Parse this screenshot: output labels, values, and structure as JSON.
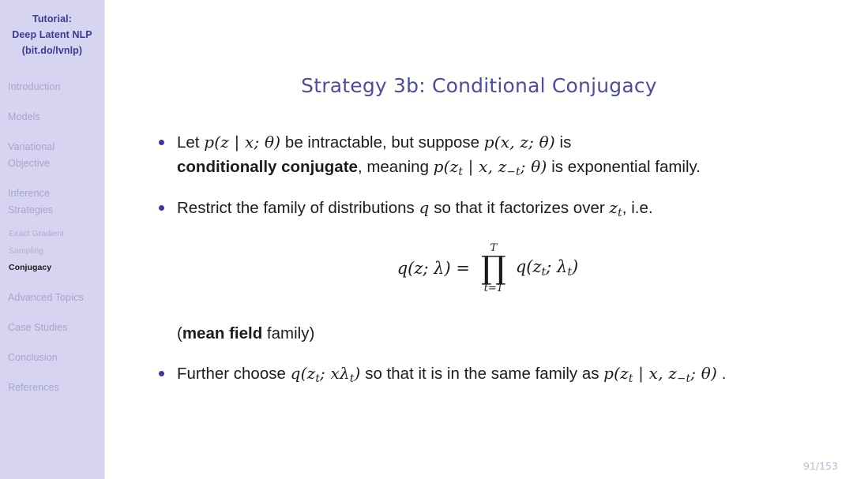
{
  "sidebar": {
    "title_lines": [
      "Tutorial:",
      "Deep Latent NLP",
      "(bit.do/lvnlp)"
    ],
    "sections": [
      {
        "lines": [
          "Introduction"
        ]
      },
      {
        "lines": [
          "Models"
        ]
      },
      {
        "lines": [
          "Variational",
          "Objective"
        ]
      },
      {
        "lines": [
          "Inference",
          "Strategies"
        ]
      }
    ],
    "subitems": [
      {
        "label": "Exact Gradient",
        "active": false
      },
      {
        "label": "Sampling",
        "active": false
      },
      {
        "label": "Conjugacy",
        "active": true
      }
    ],
    "sections_after": [
      {
        "lines": [
          "Advanced Topics"
        ]
      },
      {
        "lines": [
          "Case Studies"
        ]
      },
      {
        "lines": [
          "Conclusion"
        ]
      },
      {
        "lines": [
          "References"
        ]
      }
    ]
  },
  "slide": {
    "title": "Strategy 3b: Conditional Conjugacy",
    "page_number": "91/153",
    "bullet1": {
      "t1": "Let ",
      "m1": "p(z | x; θ)",
      "t2": " be intractable, but suppose ",
      "m2": "p(x, z; θ)",
      "t3": " is",
      "bold": "conditionally conjugate",
      "t4": ", meaning ",
      "m3_p": "p(z",
      "m3_sub": "t",
      "m3_mid": " | x, z",
      "m3_sub2": "−t",
      "m3_end": "; θ)",
      "t5": " is exponential family."
    },
    "bullet2": {
      "t1": "Restrict the family of distributions ",
      "m1": "q",
      "t2": " so that it factorizes over ",
      "m2_base": "z",
      "m2_sub": "t",
      "t3": ", i.e."
    },
    "equation": {
      "lhs_base": "q(z; λ) =",
      "prod_top": "T",
      "prod_symbol": "∏",
      "prod_bottom": "t=1",
      "rhs_base": "q(z",
      "rhs_sub1": "t",
      "rhs_mid": "; λ",
      "rhs_sub2": "t",
      "rhs_end": ")"
    },
    "meanfield": {
      "open": "(",
      "bold": "mean field",
      "rest": " family)"
    },
    "bullet3": {
      "t1": "Further choose ",
      "m1_base": "q(z",
      "m1_sub": "t",
      "m1_mid": "; xλ",
      "m1_sub2": "t",
      "m1_end": ")",
      "t2": " so that it is in the same family as ",
      "m2_base": "p(z",
      "m2_sub": "t",
      "m2_mid": " | x, z",
      "m2_sub2": "−t",
      "m2_end": "; θ)",
      "t3": " ."
    }
  },
  "colors": {
    "sidebar_bg": "#d6d4f0",
    "title_blue": "#4c4ca0",
    "bullet_blue": "#3a3a9c",
    "muted_nav": "#a7a5cc",
    "page_num": "#b9b7d8"
  }
}
